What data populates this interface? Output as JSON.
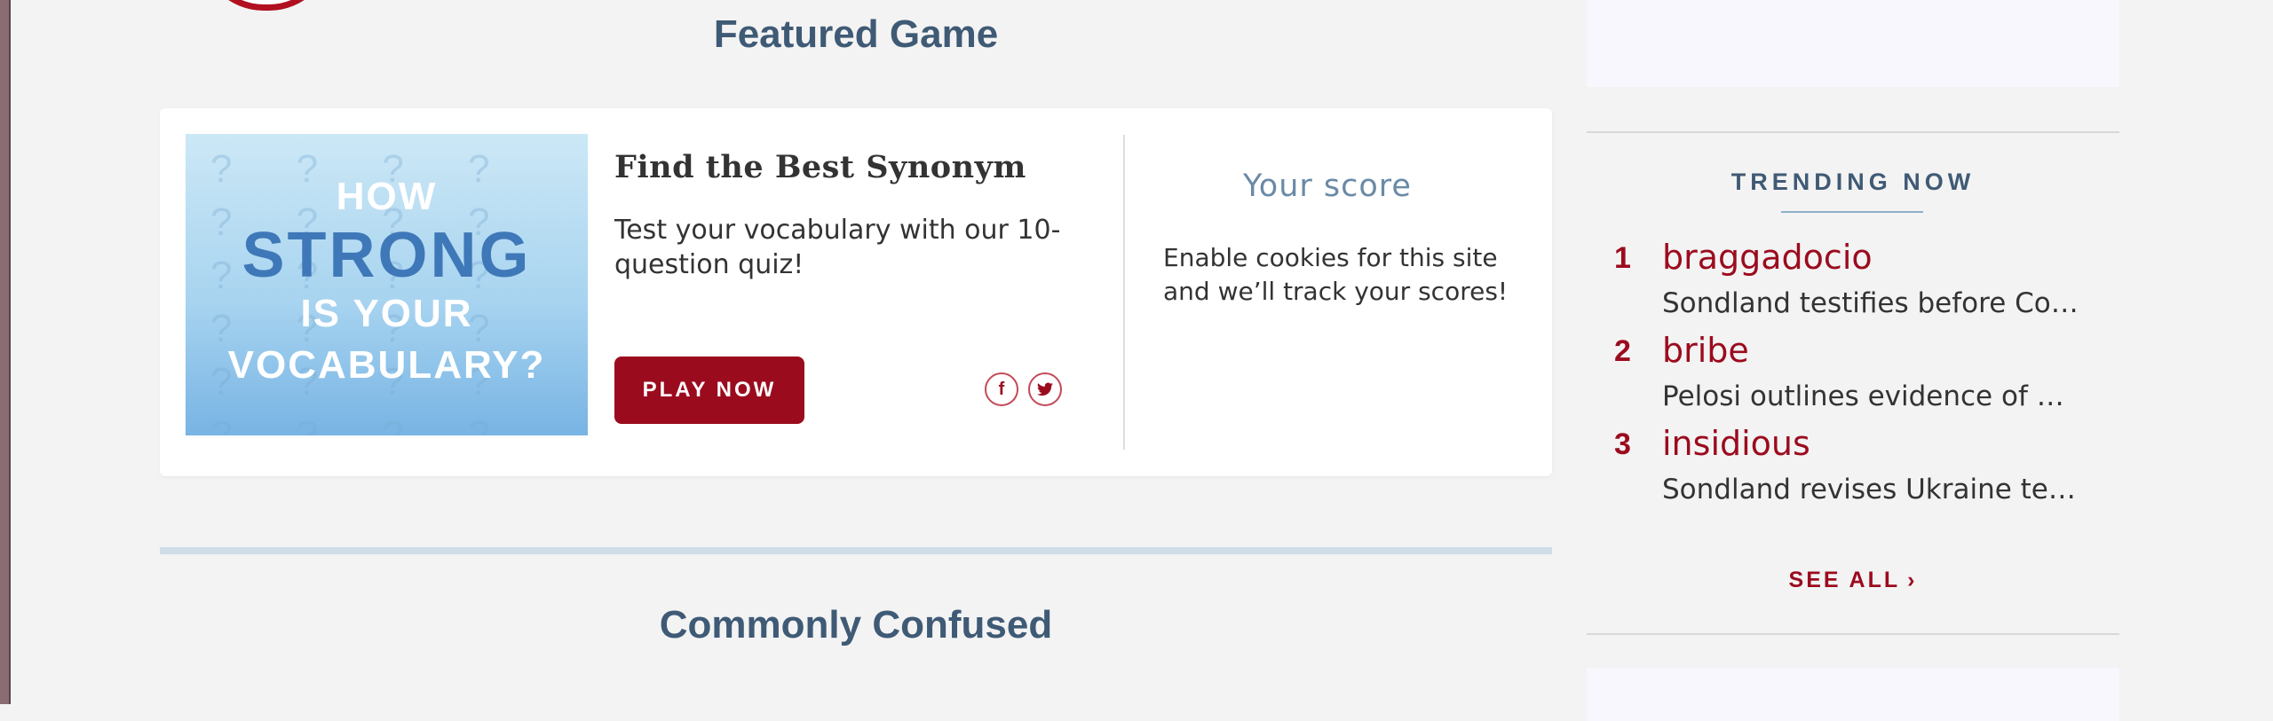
{
  "featured": {
    "heading": "Featured Game",
    "image": {
      "line1": "HOW",
      "line2": "STRONG",
      "line3": "IS YOUR",
      "line4": "VOCABULARY?"
    },
    "title": "Find the Best Synonym",
    "description": "Test your vocabulary with our 10-question quiz!",
    "play_label": "PLAY NOW",
    "score_title": "Your score",
    "score_text": "Enable cookies for this site and we’ll track your scores!",
    "social": {
      "facebook_glyph": "f",
      "twitter_glyph": "🐦"
    }
  },
  "confused": {
    "heading": "Commonly Confused"
  },
  "trending": {
    "title": "TRENDING NOW",
    "items": [
      {
        "rank": "1",
        "word": "braggadocio",
        "headline": "Sondland testifies before Co…"
      },
      {
        "rank": "2",
        "word": "bribe",
        "headline": "Pelosi outlines evidence of …"
      },
      {
        "rank": "3",
        "word": "insidious",
        "headline": "Sondland revises Ukraine te…"
      }
    ],
    "see_all": "SEE ALL",
    "chevron": "›"
  },
  "colors": {
    "brand_red": "#9b0b1e",
    "heading_blue": "#3f5a75",
    "page_bg": "#f3f3f3"
  }
}
